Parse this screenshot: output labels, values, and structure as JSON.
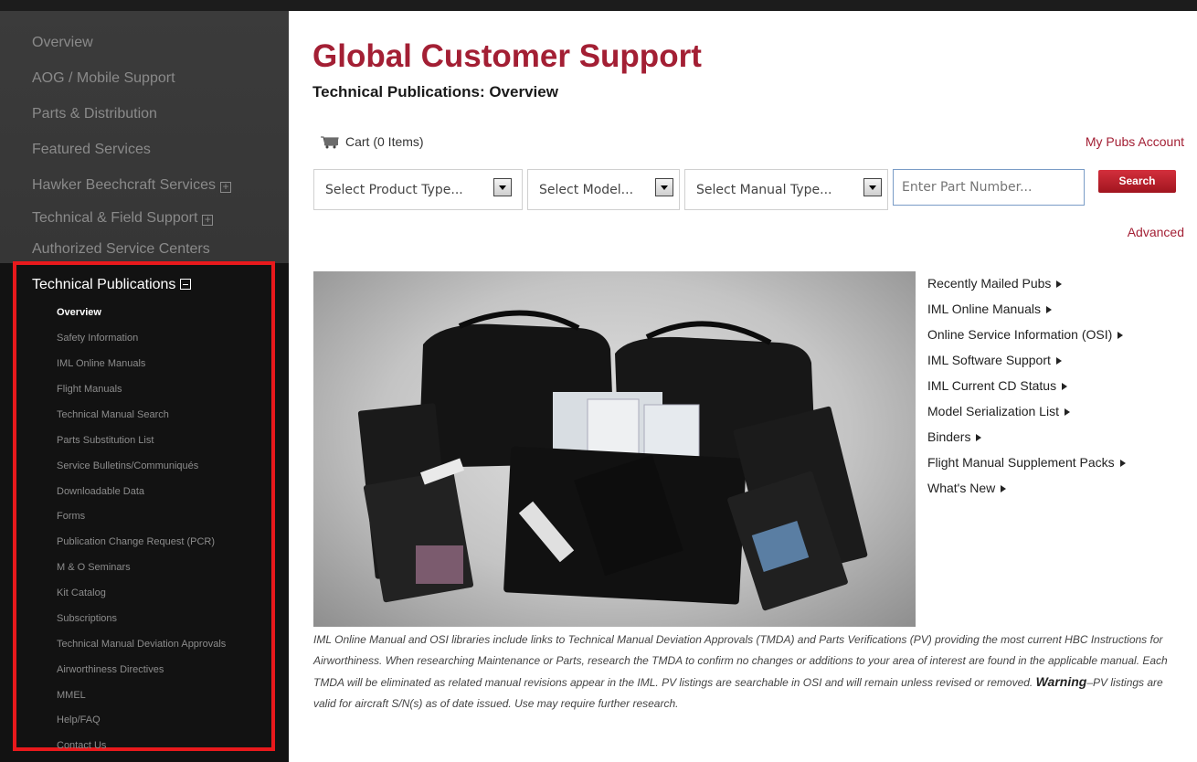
{
  "sidebar": {
    "items": [
      {
        "label": "Overview"
      },
      {
        "label": "AOG / Mobile Support"
      },
      {
        "label": "Parts & Distribution"
      },
      {
        "label": "Featured Services"
      },
      {
        "label": "Hawker Beechcraft Services",
        "expand": "+"
      },
      {
        "label": "Technical & Field Support",
        "expand": "+"
      },
      {
        "label": "Authorized Service Centers"
      }
    ],
    "section": {
      "label": "Technical Publications",
      "subitems": [
        {
          "label": "Overview"
        },
        {
          "label": "Safety Information"
        },
        {
          "label": "IML Online Manuals"
        },
        {
          "label": "Flight Manuals"
        },
        {
          "label": "Technical Manual Search"
        },
        {
          "label": "Parts Substitution List"
        },
        {
          "label": "Service Bulletins/Communiqués"
        },
        {
          "label": "Downloadable Data"
        },
        {
          "label": "Forms"
        },
        {
          "label": "Publication Change Request (PCR)"
        },
        {
          "label": "M & O Seminars"
        },
        {
          "label": "Kit Catalog"
        },
        {
          "label": "Subscriptions"
        },
        {
          "label": "Technical Manual Deviation Approvals"
        },
        {
          "label": "Airworthiness Directives"
        },
        {
          "label": "MMEL"
        },
        {
          "label": "Help/FAQ"
        },
        {
          "label": "Contact Us"
        }
      ]
    }
  },
  "header": {
    "title": "Global Customer Support",
    "subtitle": "Technical Publications: Overview"
  },
  "toolbar": {
    "cart_label": "Cart (0 Items)",
    "account_link": "My Pubs Account",
    "product_type": "Select Product Type...",
    "model": "Select Model...",
    "manual_type": "Select Manual Type...",
    "part_placeholder": "Enter Part Number...",
    "search_label": "Search",
    "advanced_link": "Advanced"
  },
  "quick_links": [
    {
      "label": "Recently Mailed Pubs"
    },
    {
      "label": "IML Online Manuals"
    },
    {
      "label": "Online Service Information (OSI)"
    },
    {
      "label": "IML Software Support"
    },
    {
      "label": "IML Current CD Status"
    },
    {
      "label": "Model Serialization List"
    },
    {
      "label": "Binders"
    },
    {
      "label": "Flight Manual Supplement Packs"
    },
    {
      "label": "What's New"
    }
  ],
  "description": {
    "text": "IML Online Manual and OSI libraries include links to Technical Manual Deviation Approvals (TMDA) and Parts Verifications (PV) providing the most current HBC Instructions for Airworthiness. When researching Maintenance or Parts, research the TMDA to confirm no changes or additions to your area of interest are found in the applicable manual. Each TMDA will be eliminated as related manual revisions appear in the IML. PV listings are searchable in OSI and will remain unless revised or removed.",
    "warning_label": "Warning",
    "warning_text": "–PV listings are valid for aircraft S/N(s) as of date issued. Use may require further research."
  },
  "colors": {
    "brand_red": "#a31f34",
    "highlight_frame": "#e8191c",
    "sidebar_bg": "#3a3a3a"
  }
}
